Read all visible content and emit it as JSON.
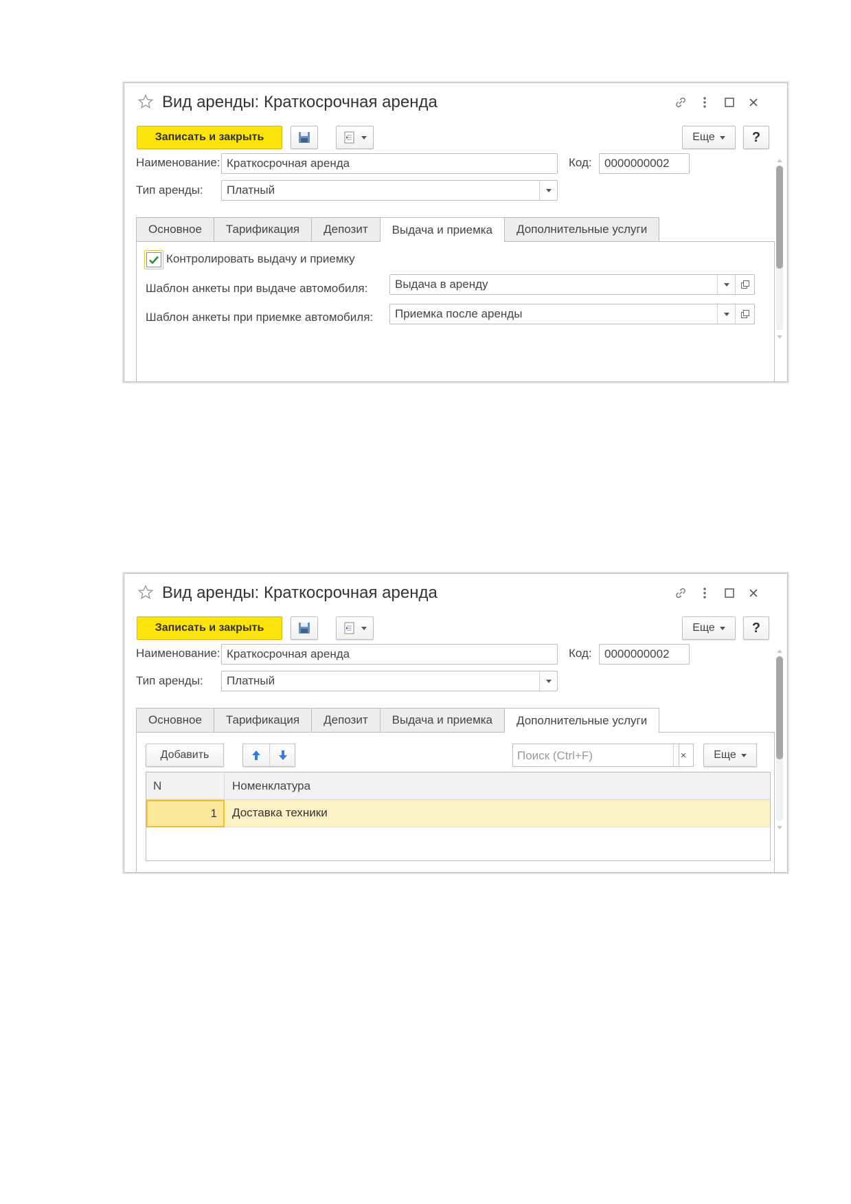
{
  "windows": [
    {
      "title": "Вид аренды: Краткосрочная аренда",
      "save_close_label": "Записать и закрыть",
      "more_label": "Еще",
      "help_label": "?",
      "name_label": "Наименование:",
      "name_value": "Краткосрочная аренда",
      "code_label": "Код:",
      "code_value": "0000000002",
      "type_label": "Тип аренды:",
      "type_value": "Платный",
      "tabs": [
        {
          "label": "Основное"
        },
        {
          "label": "Тарификация"
        },
        {
          "label": "Депозит"
        },
        {
          "label": "Выдача и приемка"
        },
        {
          "label": "Дополнительные услуги"
        }
      ],
      "active_tab": "Выдача и приемка",
      "control_checkbox": {
        "label": "Контролировать выдачу и приемку",
        "checked": true
      },
      "issue_template_label": "Шаблон анкеты при выдаче автомобиля:",
      "issue_template_value": "Выдача в аренду",
      "return_template_label": "Шаблон анкеты при приемке автомобиля:",
      "return_template_value": "Приемка после аренды"
    },
    {
      "title": "Вид аренды: Краткосрочная аренда",
      "save_close_label": "Записать и закрыть",
      "more_label": "Еще",
      "help_label": "?",
      "name_label": "Наименование:",
      "name_value": "Краткосрочная аренда",
      "code_label": "Код:",
      "code_value": "0000000002",
      "type_label": "Тип аренды:",
      "type_value": "Платный",
      "tabs": [
        {
          "label": "Основное"
        },
        {
          "label": "Тарификация"
        },
        {
          "label": "Депозит"
        },
        {
          "label": "Выдача и приемка"
        },
        {
          "label": "Дополнительные услуги"
        }
      ],
      "active_tab": "Дополнительные услуги",
      "add_label": "Добавить",
      "search_placeholder": "Поиск (Ctrl+F)",
      "search_clear": "×",
      "table_more_label": "Еще",
      "table": {
        "columns": [
          "N",
          "Номенклатура"
        ],
        "rows": [
          {
            "n": "1",
            "nomenclature": "Доставка техники"
          }
        ]
      }
    }
  ],
  "colors": {
    "primary_button": "#fde30c",
    "selected_row": "#fbf1c4",
    "selected_cell": "#fde79c",
    "check": "#2e8b3a",
    "arrow": "#2f7fd8"
  },
  "icons": [
    "star-icon",
    "link-icon",
    "more-vertical-icon",
    "maximize-icon",
    "close-icon",
    "save-icon",
    "report-icon",
    "open-icon",
    "arrow-up-icon",
    "arrow-down-icon",
    "check-icon"
  ]
}
